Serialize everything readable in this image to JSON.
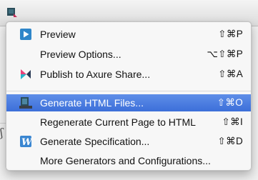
{
  "menu": {
    "items": [
      {
        "label": "Preview",
        "shortcut": "⇧⌘P",
        "icon": "preview-icon",
        "highlighted": false
      },
      {
        "label": "Preview Options...",
        "shortcut": "⌥⇧⌘P",
        "icon": "",
        "highlighted": false
      },
      {
        "label": "Publish to Axure Share...",
        "shortcut": "⇧⌘A",
        "icon": "axure-share-icon",
        "highlighted": false
      },
      {
        "label": "Generate HTML Files...",
        "shortcut": "⇧⌘O",
        "icon": "html-files-icon",
        "highlighted": true
      },
      {
        "label": "Regenerate Current Page to HTML",
        "shortcut": "⇧⌘I",
        "icon": "",
        "highlighted": false
      },
      {
        "label": "Generate Specification...",
        "shortcut": "⇧⌘D",
        "icon": "word-spec-icon",
        "highlighted": false
      },
      {
        "label": "More Generators and Configurations...",
        "shortcut": "",
        "icon": "",
        "highlighted": false
      }
    ],
    "highlight_color": "#3f72db"
  }
}
